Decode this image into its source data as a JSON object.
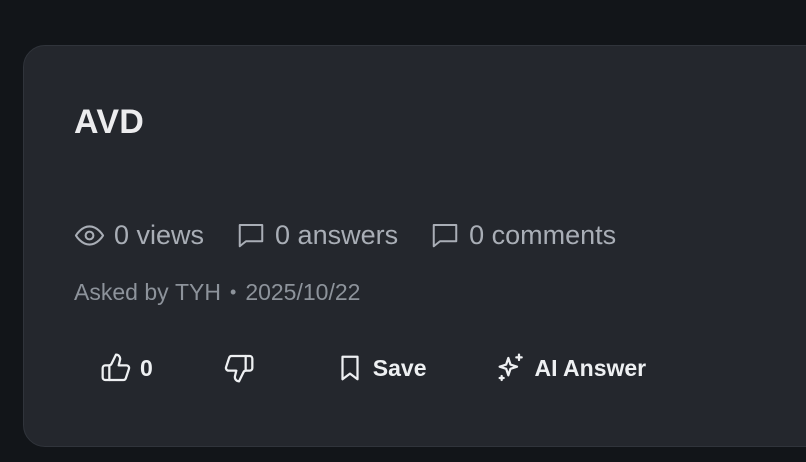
{
  "question": {
    "title": "AVD",
    "stats": {
      "views": "0 views",
      "answers": "0 answers",
      "comments": "0 comments"
    },
    "meta": {
      "asked_by_prefix": "Asked by",
      "author": "TYH",
      "separator": "•",
      "date": "2025/10/22"
    }
  },
  "actions": {
    "upvote_count": "0",
    "save_label": "Save",
    "ai_answer_label": "AI Answer"
  },
  "icons": {
    "views": "eye-icon",
    "answers": "speech-bubble-icon",
    "comments": "speech-bubble-icon",
    "upvote": "thumbs-up-icon",
    "downvote": "thumbs-down-icon",
    "save": "bookmark-icon",
    "ai_answer": "sparkles-icon"
  },
  "colors": {
    "background": "#121519",
    "card": "#24272d",
    "title": "#ececee",
    "stat_text": "#a9aeb6",
    "meta_text": "#8d939b",
    "action_text": "#eef0f2"
  }
}
